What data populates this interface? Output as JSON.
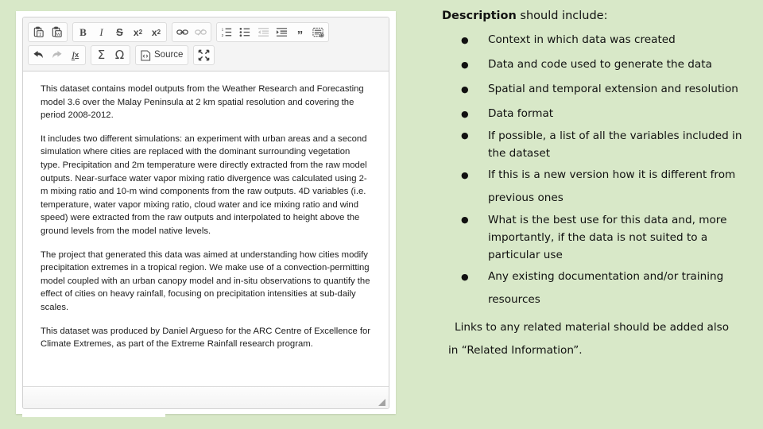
{
  "theme": {
    "page_background": "#d8e8c8",
    "panel_background": "#ffffff",
    "toolbar_background": "#f4f4f4",
    "muted_text": "#5a5a50",
    "body_text": "#1d1d1d"
  },
  "editor": {
    "toolbar": {
      "row1": [
        {
          "group": 1,
          "name": "paste-as-plain-text-icon",
          "label": "",
          "icon": "paste-text",
          "disabled": false
        },
        {
          "group": 1,
          "name": "paste-from-word-icon",
          "label": "",
          "icon": "paste-word",
          "disabled": false
        },
        {
          "group": 2,
          "name": "bold-button",
          "label": "B",
          "icon": "bold",
          "disabled": false
        },
        {
          "group": 2,
          "name": "italic-button",
          "label": "I",
          "icon": "italic",
          "disabled": false
        },
        {
          "group": 2,
          "name": "strikethrough-button",
          "label": "S",
          "icon": "strike",
          "disabled": false
        },
        {
          "group": 2,
          "name": "subscript-button",
          "label": "x",
          "icon": "subscript",
          "disabled": false
        },
        {
          "group": 2,
          "name": "superscript-button",
          "label": "x",
          "icon": "superscript",
          "disabled": false
        },
        {
          "group": 3,
          "name": "link-button",
          "label": "",
          "icon": "link",
          "disabled": false
        },
        {
          "group": 3,
          "name": "unlink-button",
          "label": "",
          "icon": "unlink",
          "disabled": true
        },
        {
          "group": 4,
          "name": "numbered-list-button",
          "label": "",
          "icon": "ordered-list",
          "disabled": false
        },
        {
          "group": 4,
          "name": "bulleted-list-button",
          "label": "",
          "icon": "unordered-list",
          "disabled": false
        },
        {
          "group": 4,
          "name": "decrease-indent-button",
          "label": "",
          "icon": "outdent",
          "disabled": true
        },
        {
          "group": 4,
          "name": "increase-indent-button",
          "label": "",
          "icon": "indent",
          "disabled": false
        },
        {
          "group": 4,
          "name": "blockquote-button",
          "label": "”",
          "icon": "blockquote",
          "disabled": false
        },
        {
          "group": 4,
          "name": "insert-template-button",
          "label": "",
          "icon": "templates",
          "disabled": false
        }
      ],
      "row2": [
        {
          "group": 1,
          "name": "undo-button",
          "label": "",
          "icon": "undo",
          "disabled": false
        },
        {
          "group": 1,
          "name": "redo-button",
          "label": "",
          "icon": "redo",
          "disabled": true
        },
        {
          "group": 1,
          "name": "remove-format-button",
          "label": "I",
          "icon": "remove-format",
          "disabled": false
        },
        {
          "group": 2,
          "name": "math-formula-button",
          "label": "Σ",
          "icon": "sigma",
          "disabled": false
        },
        {
          "group": 2,
          "name": "special-character-button",
          "label": "Ω",
          "icon": "omega",
          "disabled": false
        },
        {
          "group": 3,
          "name": "source-button",
          "label": "Source",
          "icon": "source",
          "disabled": false
        },
        {
          "group": 4,
          "name": "maximize-button",
          "label": "",
          "icon": "maximize",
          "disabled": false
        }
      ]
    },
    "content": {
      "paragraph1": "This dataset contains model outputs from the Weather Research and Forecasting model 3.6 over the Malay Peninsula at 2 km spatial resolution and covering the period 2008-2012.",
      "paragraph2": "It includes two different simulations: an experiment with urban areas and a second simulation where cities are replaced with the dominant surrounding vegetation type. Precipitation and 2m temperature were directly extracted from the raw model outputs. Near-surface water vapor mixing ratio divergence was calculated using 2-m mixing ratio and 10-m wind components from the raw outputs. 4D variables (i.e. temperature, water vapor mixing ratio, cloud water and ice mixing ratio and wind speed) were extracted from the raw outputs and interpolated to height above the ground levels from the model native levels.",
      "paragraph3": "The project that generated this data was aimed at understanding how cities modify precipitation extremes in a tropical region. We make use of a convection-permitting model coupled with an urban canopy model and in-situ observations to quantify the effect of cities on heavy rainfall, focusing on precipitation intensities at sub-daily scales.",
      "paragraph4": "This dataset was produced by Daniel Argueso for the ARC Centre of Excellence for Climate Extremes, as part of the Extreme Rainfall research program."
    }
  },
  "notes": {
    "heading_bold": "Description",
    "heading_rest": " should include:",
    "bullet_char": "●",
    "items": [
      {
        "text": "Context in which data was created",
        "muted": false,
        "spacing": "wide"
      },
      {
        "text": "Data and code used to generate the data",
        "muted": false,
        "spacing": "wide"
      },
      {
        "text": "Spatial and temporal extension and resolution",
        "muted": false,
        "spacing": "wide"
      },
      {
        "text": "Data format",
        "muted": false,
        "spacing": "wide"
      },
      {
        "text": "If possible, a list of all the variables included in the dataset",
        "muted": true,
        "spacing": "tight"
      },
      {
        "text": "If this is a new version how it is different from previous ones",
        "muted": false,
        "spacing": "wide"
      },
      {
        "text": "What is the best use for this data and, more importantly, if the data is not suited to a particular use",
        "muted": true,
        "spacing": "tight"
      },
      {
        "text": "Any existing documentation and/or training resources",
        "muted": false,
        "spacing": "wide"
      }
    ],
    "footer_line1": "Links to any related material should be  added also",
    "footer_line2": "in “Related Information”."
  }
}
